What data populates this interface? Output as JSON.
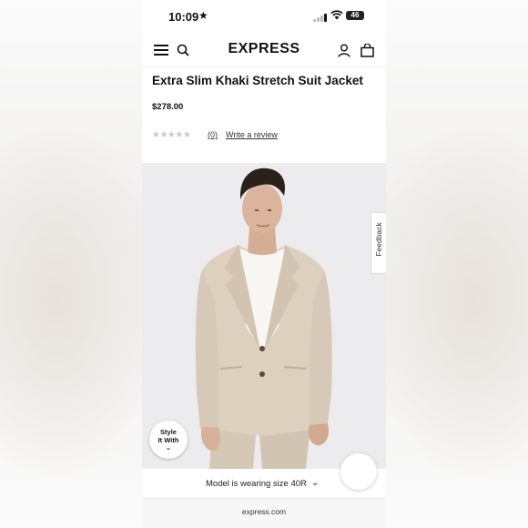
{
  "status_bar": {
    "time": "10:09",
    "battery": "46"
  },
  "nav": {
    "brand": "EXPRESS"
  },
  "product": {
    "title": "Extra Slim Khaki Stretch Suit Jacket",
    "price": "$278.00",
    "stars": "★★★★★",
    "review_count": "(0)",
    "write_review_label": "Write a review"
  },
  "hero": {
    "feedback_label": "Feedback",
    "style_it_line1": "Style",
    "style_it_line2": "It With"
  },
  "footer": {
    "model_note": "Model is wearing size 40R",
    "url": "express.com"
  },
  "colors": {
    "jacket": "#ddd0bf",
    "background": "#ececee",
    "text": "#111111"
  }
}
